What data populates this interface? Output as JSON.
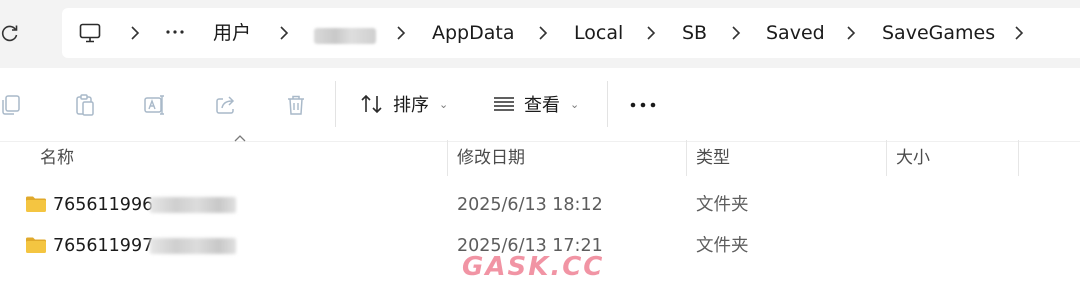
{
  "address_bar": {
    "breadcrumbs": [
      "用户",
      "AppData",
      "Local",
      "SB",
      "Saved",
      "SaveGames"
    ],
    "icons": {
      "refresh": "refresh-icon",
      "computer": "computer-icon",
      "more": "more-horizontal-icon",
      "chevron": "chevron-right-icon"
    }
  },
  "command_bar": {
    "sort_label": "排序",
    "view_label": "查看",
    "icons": [
      "copy-icon",
      "paste-icon",
      "rename-icon",
      "share-icon",
      "delete-icon",
      "sort-icon",
      "view-icon",
      "more-icon"
    ]
  },
  "columns": {
    "name": "名称",
    "date_modified": "修改日期",
    "type": "类型",
    "size": "大小"
  },
  "files": [
    {
      "name": "765611996",
      "date": "2025/6/13 18:12",
      "type": "文件夹",
      "size": ""
    },
    {
      "name": "765611997",
      "date": "2025/6/13 17:21",
      "type": "文件夹",
      "size": ""
    }
  ],
  "watermark": "GASK.CC",
  "colors": {
    "folder_fill": "#f4c541",
    "folder_tab": "#e0a92b",
    "chrome_bg": "#f3f3f3",
    "watermark": "#e63c5a"
  }
}
